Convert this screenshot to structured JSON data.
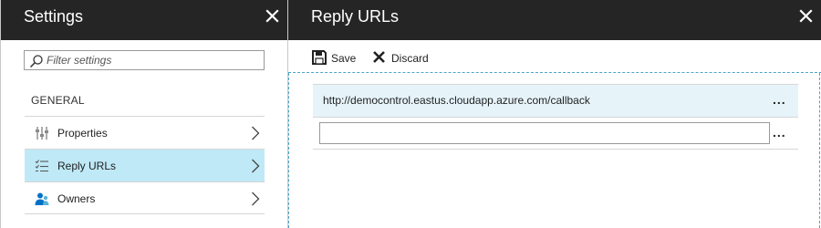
{
  "settings_blade": {
    "title": "Settings",
    "filter": {
      "placeholder": "Filter settings",
      "value": ""
    },
    "section_label": "GENERAL",
    "items": [
      {
        "label": "Properties",
        "icon": "properties-icon",
        "active": false
      },
      {
        "label": "Reply URLs",
        "icon": "list-check-icon",
        "active": true
      },
      {
        "label": "Owners",
        "icon": "owners-icon",
        "active": false
      }
    ]
  },
  "reply_blade": {
    "title": "Reply URLs",
    "toolbar": {
      "save_label": "Save",
      "discard_label": "Discard"
    },
    "urls": [
      {
        "value": "http://democontrol.eastus.cloudapp.azure.com/callback",
        "more": "..."
      }
    ],
    "new_url": {
      "value": "",
      "placeholder": "",
      "more": "..."
    }
  },
  "colors": {
    "header_bg": "#252525",
    "active_item_bg": "#bfe9f7",
    "row_highlight_bg": "#e6f4fa",
    "dashed_border": "#4da3c9",
    "owners_icon": "#0072c6"
  }
}
